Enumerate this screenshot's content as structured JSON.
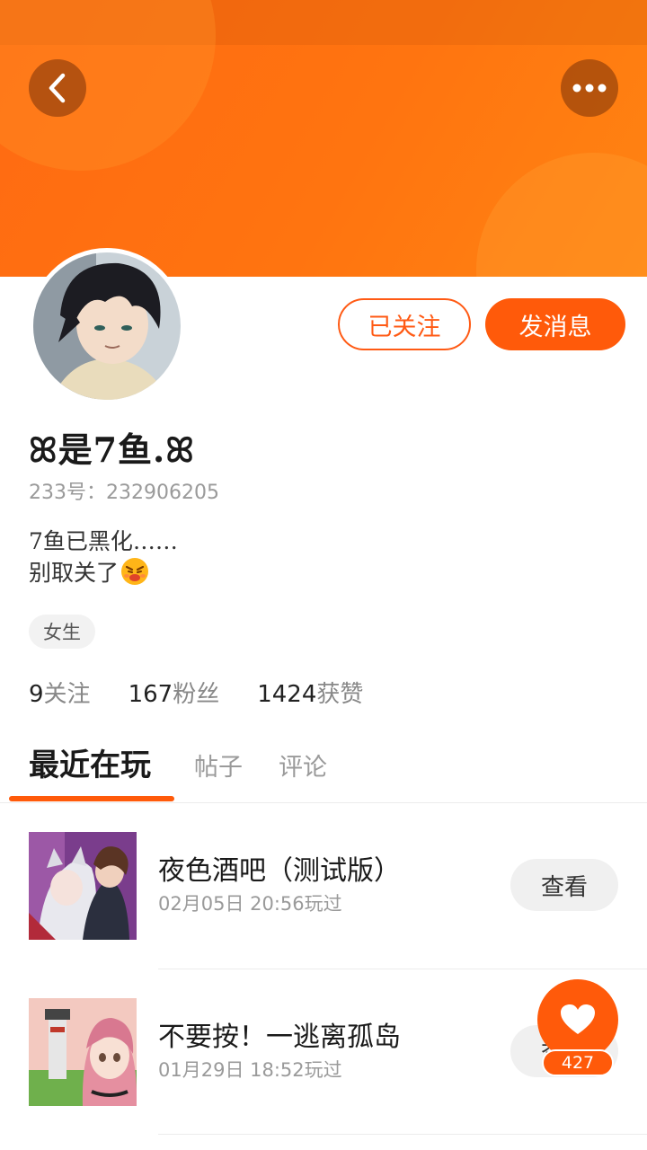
{
  "profile": {
    "username": "ꕤ是7鱼.ꕤ",
    "uid_label": "233号：232906205",
    "bio_line1": "7鱼已黑化……",
    "bio_line2": "别取关了",
    "tag": "女生",
    "follow_state_label": "已关注",
    "message_label": "发消息"
  },
  "stats": [
    {
      "value": "9",
      "label": "关注"
    },
    {
      "value": "167",
      "label": "粉丝"
    },
    {
      "value": "1424",
      "label": "获赞"
    }
  ],
  "tabs": [
    {
      "label": "最近在玩",
      "active": true
    },
    {
      "label": "帖子",
      "active": false
    },
    {
      "label": "评论",
      "active": false
    }
  ],
  "games": [
    {
      "title": "夜色酒吧（测试版）",
      "played": "02月05日  20:56玩过",
      "action": "查看"
    },
    {
      "title": "不要按！一逃离孤岛",
      "played": "01月29日  18:52玩过",
      "action": "查看"
    }
  ],
  "like": {
    "count": "427"
  },
  "colors": {
    "accent": "#ff5a0a",
    "banner": "#ff7410"
  },
  "icons": {
    "back": "chevron-left-icon",
    "more": "more-dots-icon",
    "like": "heart-icon"
  }
}
